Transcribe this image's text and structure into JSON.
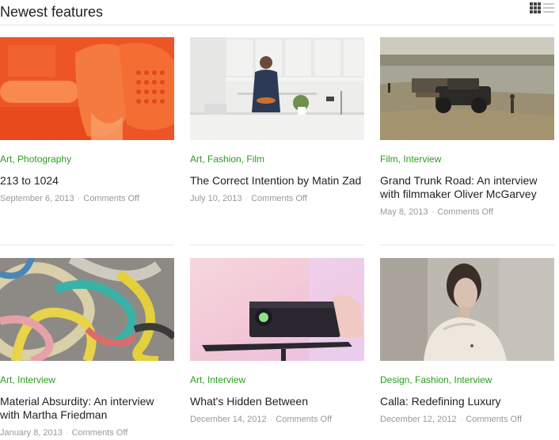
{
  "section": {
    "title": "Newest features",
    "views": [
      {
        "name": "grid-view",
        "active": true
      },
      {
        "name": "list-view",
        "active": false
      }
    ]
  },
  "posts": [
    {
      "image": "orange sculptural objects",
      "categories": [
        "Art",
        "Photography"
      ],
      "title": "213 to 1024",
      "date": "September 6, 2013",
      "comments": "Comments Off"
    },
    {
      "image": "man in white kitchen",
      "categories": [
        "Art",
        "Fashion",
        "Film"
      ],
      "title": "The Correct Intention by Matin Zad",
      "date": "July 10, 2013",
      "comments": "Comments Off"
    },
    {
      "image": "vintage car by river",
      "categories": [
        "Film",
        "Interview"
      ],
      "title": "Grand Trunk Road: An interview with filmmaker Oliver McGarvey",
      "date": "May 8, 2013",
      "comments": "Comments Off"
    },
    {
      "image": "colorful rubber loops",
      "categories": [
        "Art",
        "Interview"
      ],
      "title": "Material Absurdity: An interview with Martha Friedman",
      "date": "January 8, 2013",
      "comments": "Comments Off"
    },
    {
      "image": "projector on stand",
      "categories": [
        "Art",
        "Interview"
      ],
      "title": "What's Hidden Between",
      "date": "December 14, 2012",
      "comments": "Comments Off"
    },
    {
      "image": "woman in white dress",
      "categories": [
        "Design",
        "Fashion",
        "Interview"
      ],
      "title": "Calla: Redefining Luxury",
      "date": "December 12, 2012",
      "comments": "Comments Off"
    }
  ],
  "colors": {
    "category": "#2a9d1e",
    "meta": "#999999",
    "title": "#222222"
  }
}
